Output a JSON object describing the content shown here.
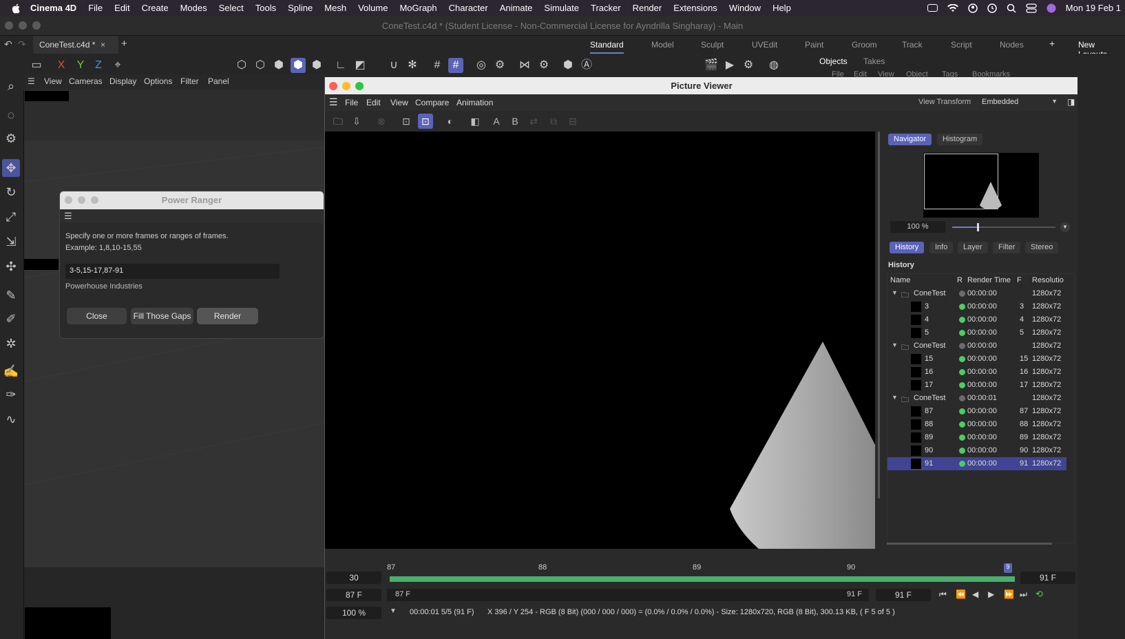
{
  "menubar": {
    "app": "Cinema 4D",
    "items": [
      "File",
      "Edit",
      "Create",
      "Modes",
      "Select",
      "Tools",
      "Spline",
      "Mesh",
      "Volume",
      "MoGraph",
      "Character",
      "Animate",
      "Simulate",
      "Tracker",
      "Render",
      "Extensions",
      "Window",
      "Help"
    ],
    "datetime": "Mon 19 Feb 1"
  },
  "window": {
    "title": "ConeTest.c4d * (Student License - Non-Commercial License for Ayndrilla Singharay) - Main"
  },
  "doc_tab": {
    "label": "ConeTest.c4d *",
    "close": "×",
    "add": "+"
  },
  "layouts": {
    "items": [
      "Standard",
      "Model",
      "Sculpt",
      "UVEdit",
      "Paint",
      "Groom",
      "Track",
      "Script",
      "Nodes"
    ],
    "add": "+",
    "new_layouts": "New Layouts"
  },
  "axes": {
    "x": "X",
    "y": "Y",
    "z": "Z"
  },
  "viewport_menu": [
    "View",
    "Cameras",
    "Display",
    "Options",
    "Filter",
    "Panel"
  ],
  "objects_panel": {
    "tabs": [
      "Objects",
      "Takes"
    ],
    "menu": [
      "File",
      "Edit",
      "View",
      "Object",
      "Tags",
      "Bookmarks"
    ]
  },
  "power_ranger": {
    "title": "Power Ranger",
    "instruction": "Specify one or more frames or ranges of frames.",
    "example": "Example: 1,8,10-15,55",
    "input_value": "3-5,15-17,87-91",
    "company": "Powerhouse Industries",
    "close_label": "Close",
    "fill_label": "Fill Those Gaps",
    "render_label": "Render"
  },
  "picture_viewer": {
    "title": "Picture Viewer",
    "menu": [
      "File",
      "Edit",
      "View",
      "Compare",
      "Animation"
    ],
    "view_transform_label": "View Transform",
    "view_transform_value": "Embedded",
    "tool_a": "A",
    "tool_b": "B",
    "side_tabs": [
      "Navigator",
      "Histogram"
    ],
    "zoom": "100 %",
    "history_tabs": [
      "History",
      "Info",
      "Layer",
      "Filter",
      "Stereo"
    ],
    "history_title": "History",
    "columns": [
      "Name",
      "R",
      "Render Time",
      "F",
      "Resolutio"
    ],
    "rows": [
      {
        "name": "ConeTest",
        "group": true,
        "time": "00:00:00",
        "f": "",
        "res": "1280x72",
        "status": "grey"
      },
      {
        "name": "3",
        "group": false,
        "time": "00:00:00",
        "f": "3",
        "res": "1280x72",
        "status": "green"
      },
      {
        "name": "4",
        "group": false,
        "time": "00:00:00",
        "f": "4",
        "res": "1280x72",
        "status": "green"
      },
      {
        "name": "5",
        "group": false,
        "time": "00:00:00",
        "f": "5",
        "res": "1280x72",
        "status": "green"
      },
      {
        "name": "ConeTest",
        "group": true,
        "time": "00:00:00",
        "f": "",
        "res": "1280x72",
        "status": "grey"
      },
      {
        "name": "15",
        "group": false,
        "time": "00:00:00",
        "f": "15",
        "res": "1280x72",
        "status": "green"
      },
      {
        "name": "16",
        "group": false,
        "time": "00:00:00",
        "f": "16",
        "res": "1280x72",
        "status": "green"
      },
      {
        "name": "17",
        "group": false,
        "time": "00:00:00",
        "f": "17",
        "res": "1280x72",
        "status": "green"
      },
      {
        "name": "ConeTest",
        "group": true,
        "time": "00:00:01",
        "f": "",
        "res": "1280x72",
        "status": "grey"
      },
      {
        "name": "87",
        "group": false,
        "time": "00:00:00",
        "f": "87",
        "res": "1280x72",
        "status": "green"
      },
      {
        "name": "88",
        "group": false,
        "time": "00:00:00",
        "f": "88",
        "res": "1280x72",
        "status": "green"
      },
      {
        "name": "89",
        "group": false,
        "time": "00:00:00",
        "f": "89",
        "res": "1280x72",
        "status": "green"
      },
      {
        "name": "90",
        "group": false,
        "time": "00:00:00",
        "f": "90",
        "res": "1280x72",
        "status": "green"
      },
      {
        "name": "91",
        "group": false,
        "time": "00:00:00",
        "f": "91",
        "res": "1280x72",
        "status": "green",
        "selected": true
      }
    ],
    "timeline": {
      "fps": "30",
      "ticks": [
        "87",
        "88",
        "89",
        "90",
        "9"
      ],
      "end_frame": "91 F",
      "start_field": "87 F",
      "range_start": "87 F",
      "range_end": "91 F",
      "current": "91 F"
    },
    "status": {
      "zoom": "100 %",
      "time": "00:00:01 5/5 (91 F)",
      "pixel_info": "X 396 / Y 254 - RGB (8 Bit) (000 / 000 / 000) = (0.0% / 0.0% / 0.0%) - Size: 1280x720, RGB (8 Bit), 300.13 KB,  ( F 5 of 5 )"
    }
  },
  "colors": {
    "accent": "#5b63b7",
    "green": "#4ccd62",
    "grey_dot": "#6b6b6b"
  }
}
